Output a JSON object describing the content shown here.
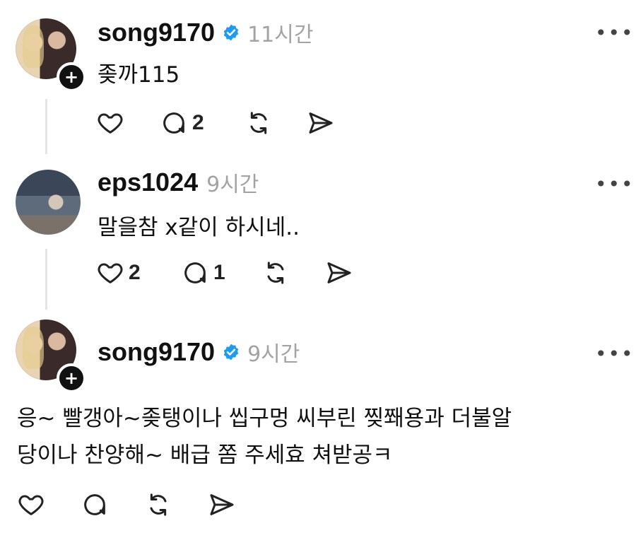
{
  "posts": [
    {
      "username": "song9170",
      "time": "11시간",
      "text": "좆까115",
      "likes": "",
      "replies": "2"
    },
    {
      "username": "eps1024",
      "time": "9시간",
      "text": "말을참 x같이 하시네..",
      "likes": "2",
      "replies": "1"
    },
    {
      "username": "song9170",
      "time": "9시간",
      "text_line1": "응~ 빨갱아~좆탱이나 씹구멍 씨부린 찢쫴용과 더불알",
      "text_line2": "당이나 찬양해~ 배급 쫌 주세효 쳐받공ㅋ",
      "likes": "",
      "replies": ""
    }
  ],
  "icons": {
    "more": "more-icon",
    "verified": "verified-icon",
    "like": "heart-icon",
    "reply": "comment-icon",
    "repost": "repost-icon",
    "share": "share-icon",
    "follow": "plus-icon"
  },
  "colors": {
    "verified": "#1d9bf0",
    "muted": "#a3a3a3"
  }
}
